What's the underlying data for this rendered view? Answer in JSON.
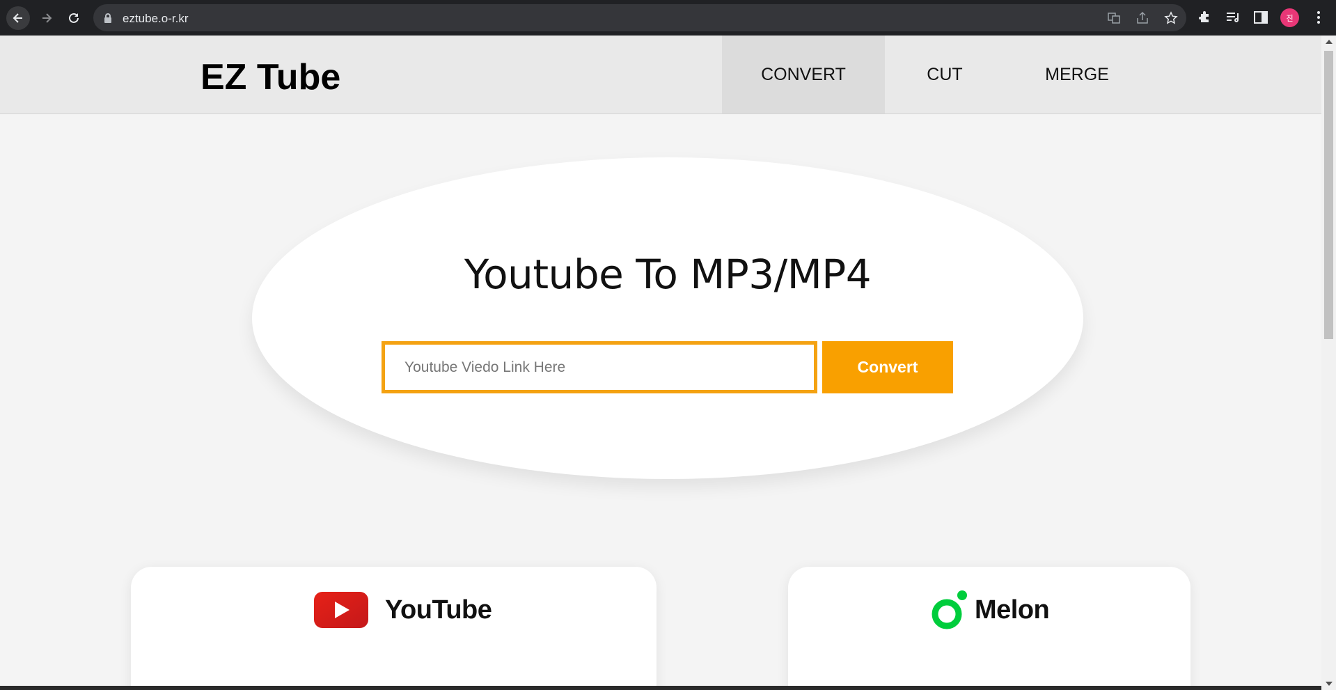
{
  "browser": {
    "url": "eztube.o-r.kr",
    "profile_initial": "진",
    "icons": [
      "back-icon",
      "forward-icon",
      "reload-icon",
      "lock-icon",
      "translate-icon",
      "share-icon",
      "star-icon",
      "extensions-icon",
      "media-queue-icon",
      "side-panel-icon",
      "menu-icon"
    ]
  },
  "header": {
    "logo": "EZ Tube",
    "nav": [
      {
        "label": "CONVERT",
        "active": true
      },
      {
        "label": "CUT",
        "active": false
      },
      {
        "label": "MERGE",
        "active": false
      }
    ]
  },
  "hero": {
    "title": "Youtube To MP3/MP4",
    "input_placeholder": "Youtube Viedo Link Here",
    "input_value": "",
    "button_label": "Convert",
    "accent_color": "#f9a000"
  },
  "cards": [
    {
      "label": "YouTube",
      "icon": "youtube-logo-icon",
      "brand_color": "#e62117"
    },
    {
      "label": "Melon",
      "icon": "melon-logo-icon",
      "brand_color": "#00cd3c"
    }
  ]
}
